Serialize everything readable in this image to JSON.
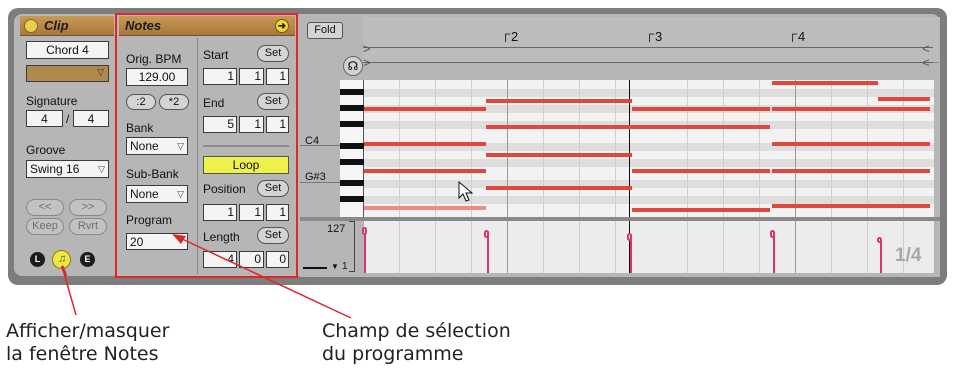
{
  "clip": {
    "title": "Clip",
    "name": "Chord 4",
    "signature_label": "Signature",
    "signature_num": "4",
    "signature_sep": "/",
    "signature_den": "4",
    "groove_label": "Groove",
    "groove_value": "Swing 16",
    "nudge_back": "<<",
    "nudge_fwd": ">>",
    "keep": "Keep",
    "revert": "Rvrt",
    "buttons": [
      "L",
      "E"
    ]
  },
  "notes": {
    "title": "Notes",
    "orig_bpm_label": "Orig. BPM",
    "orig_bpm_value": "129.00",
    "halve": ":2",
    "double": "*2",
    "bank_label": "Bank",
    "bank_value": "None",
    "subbank_label": "Sub-Bank",
    "subbank_value": "None",
    "program_label": "Program",
    "program_value": "20",
    "start_label": "Start",
    "start_values": [
      "1",
      "1",
      "1"
    ],
    "end_label": "End",
    "end_values": [
      "5",
      "1",
      "1"
    ],
    "set_label": "Set",
    "loop_label": "Loop",
    "position_label": "Position",
    "position_values": [
      "1",
      "1",
      "1"
    ],
    "length_label": "Length",
    "length_values": [
      "4",
      "0",
      "0"
    ]
  },
  "editor": {
    "fold_label": "Fold",
    "ruler_marks": [
      "2",
      "3",
      "4"
    ],
    "key_labels": [
      "C4",
      "G#3"
    ],
    "velocity_top": "127",
    "velocity_bottom": "1",
    "grid_label": "1/4"
  },
  "annotations": {
    "left": [
      "Afficher/masquer",
      "la fenêtre Notes"
    ],
    "right": [
      "Champ de sélection",
      "du programme"
    ]
  },
  "colors": {
    "note": "#e0473f",
    "velocity": "#e0336a",
    "loop": "#eef14a",
    "highlight": "#e1262a"
  }
}
